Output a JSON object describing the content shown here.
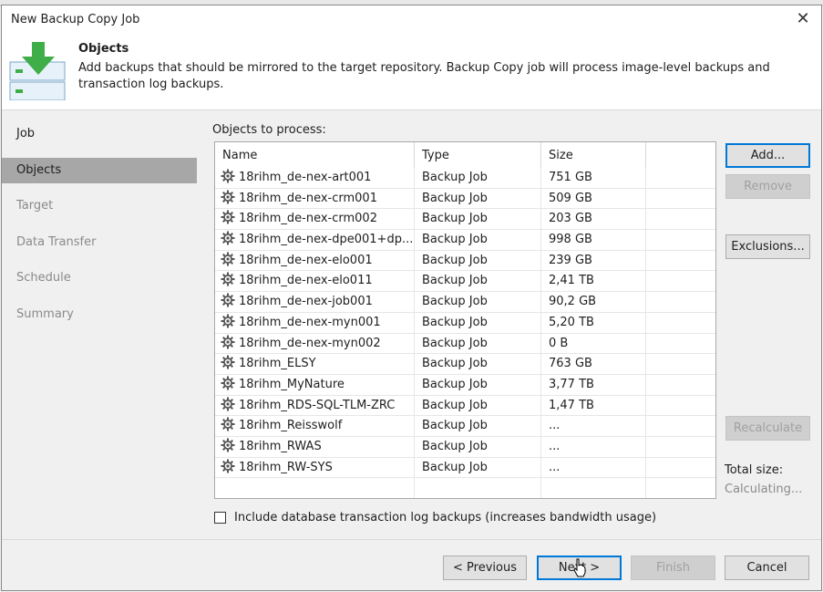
{
  "dialog": {
    "title": "New Backup Copy Job",
    "close_glyph": "✕"
  },
  "header": {
    "title": "Objects",
    "description": "Add backups that should be mirrored to the target repository. Backup Copy job will process image-level backups and transaction log backups.",
    "icon": "backup-copy-icon"
  },
  "sidebar": {
    "items": [
      {
        "label": "Job"
      },
      {
        "label": "Objects"
      },
      {
        "label": "Target"
      },
      {
        "label": "Data Transfer"
      },
      {
        "label": "Schedule"
      },
      {
        "label": "Summary"
      }
    ],
    "active": "Objects"
  },
  "objects": {
    "label": "Objects to process:",
    "columns": {
      "name": "Name",
      "type": "Type",
      "size": "Size"
    },
    "rows": [
      {
        "name": "18rihm_de-nex-art001",
        "type": "Backup Job",
        "size": "751 GB"
      },
      {
        "name": "18rihm_de-nex-crm001",
        "type": "Backup Job",
        "size": "509 GB"
      },
      {
        "name": "18rihm_de-nex-crm002",
        "type": "Backup Job",
        "size": "203 GB"
      },
      {
        "name": "18rihm_de-nex-dpe001+dp...",
        "type": "Backup Job",
        "size": "998 GB"
      },
      {
        "name": "18rihm_de-nex-elo001",
        "type": "Backup Job",
        "size": "239 GB"
      },
      {
        "name": "18rihm_de-nex-elo011",
        "type": "Backup Job",
        "size": "2,41 TB"
      },
      {
        "name": "18rihm_de-nex-job001",
        "type": "Backup Job",
        "size": "90,2 GB"
      },
      {
        "name": "18rihm_de-nex-myn001",
        "type": "Backup Job",
        "size": "5,20 TB"
      },
      {
        "name": "18rihm_de-nex-myn002",
        "type": "Backup Job",
        "size": "0 B"
      },
      {
        "name": "18rihm_ELSY",
        "type": "Backup Job",
        "size": "763 GB"
      },
      {
        "name": "18rihm_MyNature",
        "type": "Backup Job",
        "size": "3,77 TB"
      },
      {
        "name": "18rihm_RDS-SQL-TLM-ZRC",
        "type": "Backup Job",
        "size": "1,47 TB"
      },
      {
        "name": "18rihm_Reisswolf",
        "type": "Backup Job",
        "size": "..."
      },
      {
        "name": "18rihm_RWAS",
        "type": "Backup Job",
        "size": "..."
      },
      {
        "name": "18rihm_RW-SYS",
        "type": "Backup Job",
        "size": "..."
      }
    ]
  },
  "side_buttons": {
    "add": "Add...",
    "remove": "Remove",
    "exclusions": "Exclusions...",
    "recalculate": "Recalculate"
  },
  "total": {
    "label": "Total size:",
    "value": "Calculating..."
  },
  "checkbox": {
    "label": "Include database transaction log backups (increases bandwidth usage)",
    "checked": false
  },
  "footer": {
    "previous": "< Previous",
    "next": "Next >",
    "finish": "Finish",
    "cancel": "Cancel"
  },
  "colors": {
    "accent": "#0078d7",
    "active_nav": "#a7a7a7",
    "icon_green": "#3fae49"
  }
}
